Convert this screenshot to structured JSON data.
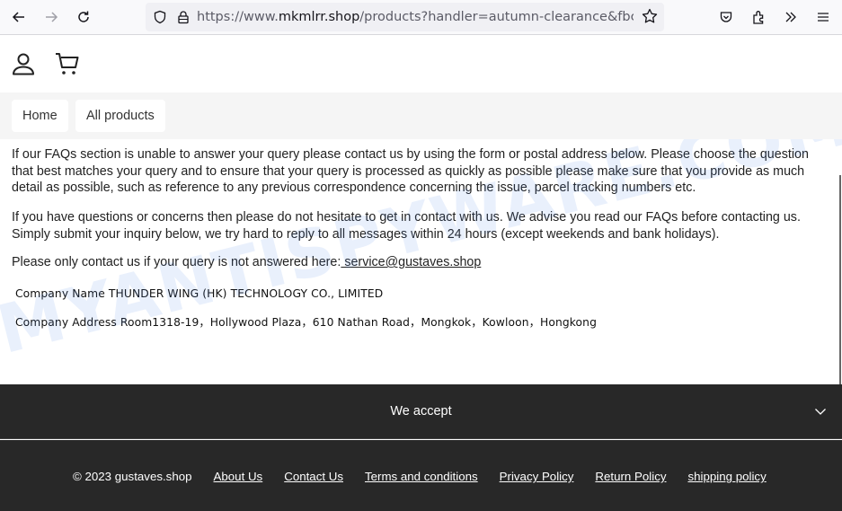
{
  "browser": {
    "url_prefix": "https://www.",
    "url_host": "mkmlrr.shop",
    "url_path": "/products?handler=autumn-clearance&fbclid=",
    "icons": {
      "back": "arrow-left-icon",
      "forward": "arrow-right-icon",
      "reload": "reload-icon",
      "tracking": "shield-icon",
      "lock": "lock-icon",
      "bookmark": "star-icon",
      "pocket": "pocket-icon",
      "extensions": "puzzle-icon",
      "overflow": "double-chevron-icon",
      "menu": "hamburger-icon"
    }
  },
  "header": {
    "icons": [
      "user-icon",
      "cart-icon"
    ],
    "menu": [
      {
        "label": "Home"
      },
      {
        "label": "All products"
      }
    ]
  },
  "content": {
    "para1": "If our FAQs section is unable to answer your query please contact us by using the form or postal address below. Please choose the question that best matches your query and to ensure that your query is processed as quickly as possible please make sure that you provide as much detail as possible, such as reference to any previous correspondence concerning the issue, parcel tracking numbers etc.",
    "para2": "If you have questions or concerns then please do not hesitate to get in contact with us. We advise you read our FAQs before contacting us. Simply submit your inquiry below, we try hard to reply to all messages within 24 hours (except weekends and bank holidays).",
    "para3_text": "Please only contact us if your query is not answered here:",
    "email": " service@gustaves.shop",
    "company_name": "Company Name THUNDER WING (HK) TECHNOLOGY CO., LIMITED",
    "company_address": "Company Address Room1318-19，Hollywood Plaza，610 Nathan Road，Mongkok，Kowloon，Hongkong"
  },
  "watermark": "MYANTISPYWARE.COM",
  "footer": {
    "accept_label": "We accept",
    "copyright": "© 2023 gustaves.shop",
    "links": [
      {
        "label": "About Us"
      },
      {
        "label": "Contact Us"
      },
      {
        "label": "Terms and conditions"
      },
      {
        "label": "Privacy Policy"
      },
      {
        "label": "Return Policy"
      },
      {
        "label": "shipping policy"
      }
    ]
  }
}
